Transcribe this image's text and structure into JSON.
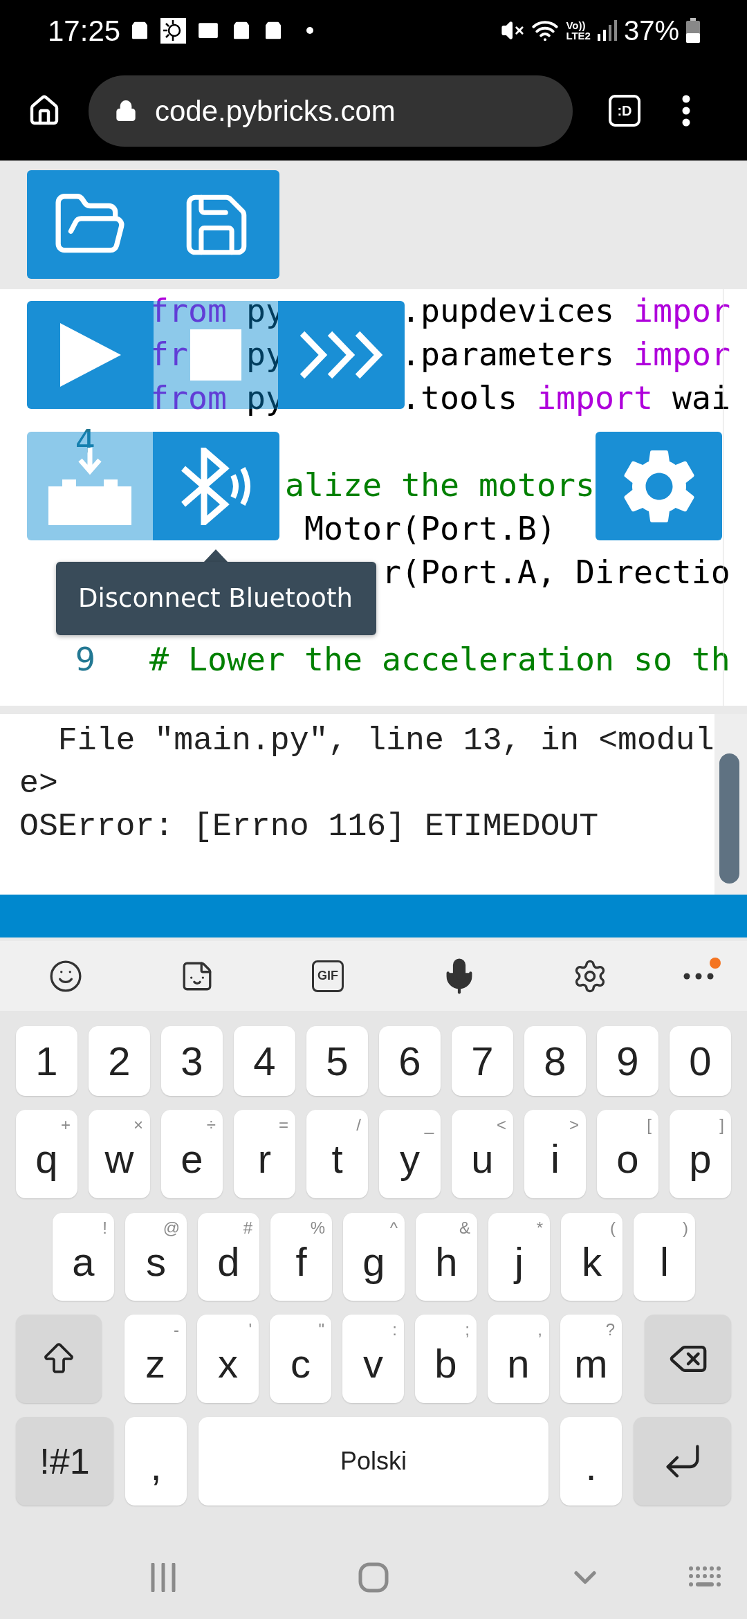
{
  "status_bar": {
    "time": "17:25",
    "network_labels": [
      "Vo))",
      "LTE2"
    ],
    "battery": "37%"
  },
  "browser": {
    "url": "code.pybricks.com",
    "tabs_label": ":D"
  },
  "editor": {
    "lines": [
      {
        "kind": "code",
        "segments": [
          [
            {
              "kind": "keyword",
              "text": "from"
            },
            {
              "kind": "plain",
              "text": " py"
            }
          ],
          [
            {
              "kind": "plain",
              "text": ".pupdevices "
            },
            {
              "kind": "keyword",
              "text": "impor"
            }
          ]
        ]
      },
      {
        "kind": "code",
        "segments": [
          [
            {
              "kind": "keyword",
              "text": "fr"
            }
          ],
          [
            {
              "kind": "plain",
              "text": "py"
            }
          ],
          [
            {
              "kind": "plain",
              "text": ".parameters "
            },
            {
              "kind": "keyword",
              "text": "impor"
            }
          ]
        ]
      },
      {
        "kind": "code",
        "segments": [
          [
            {
              "kind": "keyword",
              "text": "from"
            },
            {
              "kind": "plain",
              "text": " py"
            }
          ],
          [
            {
              "kind": "plain",
              "text": ".tools "
            },
            {
              "kind": "keyword",
              "text": "import"
            },
            {
              "kind": "plain",
              "text": " wai"
            }
          ]
        ]
      },
      {
        "kind": "code",
        "number": "4"
      },
      {
        "kind": "code",
        "segments": [
          [
            {
              "kind": "comment",
              "text": "alize the motors"
            }
          ]
        ]
      },
      {
        "kind": "code",
        "segments": [
          [
            {
              "kind": "plain",
              "text": "Motor(Port.B)"
            }
          ]
        ]
      },
      {
        "kind": "code",
        "segments": [
          [
            {
              "kind": "plain",
              "text": "r(Port.A, Directio"
            }
          ]
        ]
      },
      {
        "kind": "blank"
      },
      {
        "kind": "code",
        "number": "9",
        "segments": [
          [
            {
              "kind": "comment",
              "text": "# Lower the acceleration so th"
            }
          ]
        ]
      }
    ]
  },
  "tooltip": {
    "text": "Disconnect Bluetooth"
  },
  "console": {
    "lines": [
      "  File \"main.py\", line 13, in <modul",
      "e>",
      "OSError: [Errno 116] ETIMEDOUT"
    ]
  },
  "keyboard": {
    "gif_label": "GIF",
    "rows": [
      {
        "keys": [
          {
            "kind": "char",
            "label": "1"
          },
          {
            "kind": "char",
            "label": "2"
          },
          {
            "kind": "char",
            "label": "3"
          },
          {
            "kind": "char",
            "label": "4"
          },
          {
            "kind": "char",
            "label": "5"
          },
          {
            "kind": "char",
            "label": "6"
          },
          {
            "kind": "char",
            "label": "7"
          },
          {
            "kind": "char",
            "label": "8"
          },
          {
            "kind": "char",
            "label": "9"
          },
          {
            "kind": "char",
            "label": "0"
          }
        ]
      },
      {
        "keys": [
          {
            "kind": "char",
            "label": "q",
            "hint": "+"
          },
          {
            "kind": "char",
            "label": "w",
            "hint": "×"
          },
          {
            "kind": "char",
            "label": "e",
            "hint": "÷"
          },
          {
            "kind": "char",
            "label": "r",
            "hint": "="
          },
          {
            "kind": "char",
            "label": "t",
            "hint": "/"
          },
          {
            "kind": "char",
            "label": "y",
            "hint": "_"
          },
          {
            "kind": "char",
            "label": "u",
            "hint": "<"
          },
          {
            "kind": "char",
            "label": "i",
            "hint": ">"
          },
          {
            "kind": "char",
            "label": "o",
            "hint": "["
          },
          {
            "kind": "char",
            "label": "p",
            "hint": "]"
          }
        ]
      },
      {
        "keys": [
          {
            "kind": "char",
            "label": "a",
            "hint": "!"
          },
          {
            "kind": "char",
            "label": "s",
            "hint": "@"
          },
          {
            "kind": "char",
            "label": "d",
            "hint": "#"
          },
          {
            "kind": "char",
            "label": "f",
            "hint": "%"
          },
          {
            "kind": "char",
            "label": "g",
            "hint": "^"
          },
          {
            "kind": "char",
            "label": "h",
            "hint": "&"
          },
          {
            "kind": "char",
            "label": "j",
            "hint": "*"
          },
          {
            "kind": "char",
            "label": "k",
            "hint": "("
          },
          {
            "kind": "char",
            "label": "l",
            "hint": ")"
          }
        ]
      },
      {
        "keys": [
          {
            "kind": "shift"
          },
          {
            "kind": "char",
            "label": "z",
            "hint": "-"
          },
          {
            "kind": "char",
            "label": "x",
            "hint": "'"
          },
          {
            "kind": "char",
            "label": "c",
            "hint": "\""
          },
          {
            "kind": "char",
            "label": "v",
            "hint": ":"
          },
          {
            "kind": "char",
            "label": "b",
            "hint": ";"
          },
          {
            "kind": "char",
            "label": "n",
            "hint": ","
          },
          {
            "kind": "char",
            "label": "m",
            "hint": "?"
          },
          {
            "kind": "backspace"
          }
        ]
      },
      {
        "keys": [
          {
            "kind": "symbols",
            "label": "!#1"
          },
          {
            "kind": "char",
            "label": ","
          },
          {
            "kind": "space",
            "label": "Polski"
          },
          {
            "kind": "char",
            "label": "."
          },
          {
            "kind": "enter"
          }
        ]
      }
    ]
  }
}
